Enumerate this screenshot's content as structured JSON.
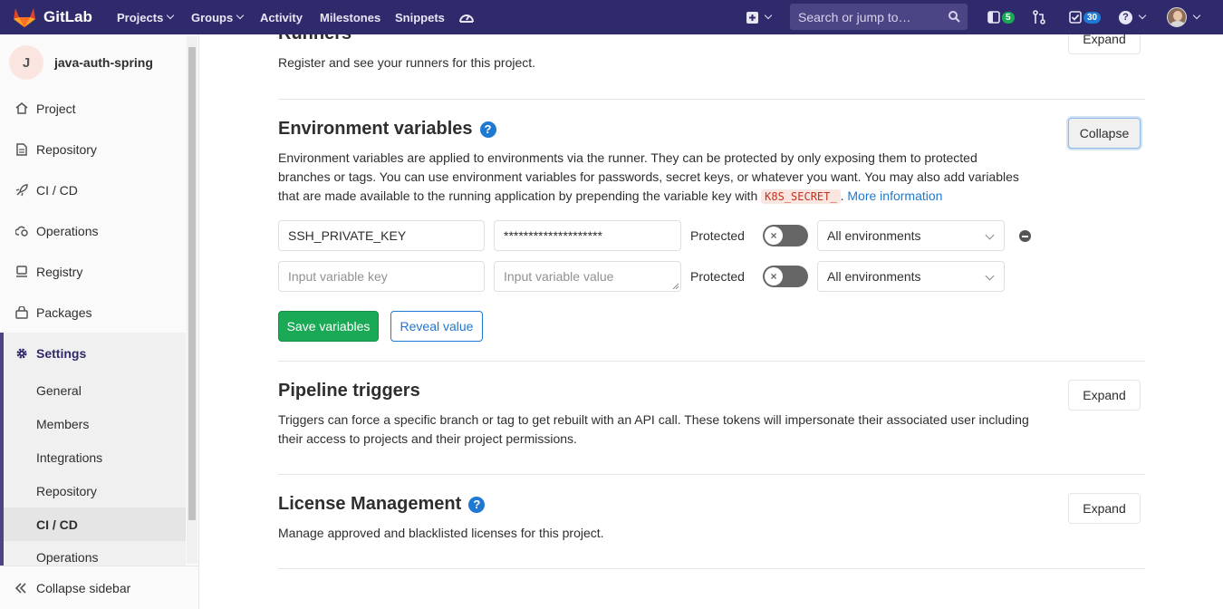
{
  "navbar": {
    "brand": "GitLab",
    "items": [
      {
        "label": "Projects",
        "dropdown": true
      },
      {
        "label": "Groups",
        "dropdown": true
      },
      {
        "label": "Activity"
      },
      {
        "label": "Milestones"
      },
      {
        "label": "Snippets"
      }
    ],
    "search_placeholder": "Search or jump to…",
    "merge_requests_count": "5",
    "todos_count": "30",
    "colors": {
      "bg": "#2f2a6b",
      "mr_badge": "#1aaa55",
      "todo_badge": "#1f78d1"
    }
  },
  "sidebar": {
    "project_initial": "J",
    "project_name": "java-auth-spring",
    "items": [
      {
        "label": "Project",
        "icon": "home-icon"
      },
      {
        "label": "Repository",
        "icon": "doc-icon"
      },
      {
        "label": "CI / CD",
        "icon": "rocket-icon"
      },
      {
        "label": "Operations",
        "icon": "cloud-gear-icon"
      },
      {
        "label": "Registry",
        "icon": "container-icon"
      },
      {
        "label": "Packages",
        "icon": "package-icon"
      },
      {
        "label": "Settings",
        "icon": "gear-icon"
      }
    ],
    "settings_sub": [
      "General",
      "Members",
      "Integrations",
      "Repository",
      "CI / CD",
      "Operations"
    ],
    "active_sub": "CI / CD",
    "collapse_label": "Collapse sidebar"
  },
  "runners": {
    "title": "Runners",
    "desc": "Register and see your runners for this project.",
    "button": "Expand"
  },
  "env_vars": {
    "title": "Environment variables",
    "button": "Collapse",
    "desc_part1": "Environment variables are applied to environments via the runner. They can be protected by only exposing them to protected branches or tags. You can use environment variables for passwords, secret keys, or whatever you want. You may also add variables that are made available to the running application by prepending the variable key with",
    "k8s_code": "K8S_SECRET_",
    "more_info": "More information",
    "rows": [
      {
        "key": "SSH_PRIVATE_KEY",
        "value": "********************",
        "protected_label": "Protected",
        "scope": "All environments"
      },
      {
        "key_placeholder": "Input variable key",
        "value_placeholder": "Input variable value",
        "protected_label": "Protected",
        "scope": "All environments"
      }
    ],
    "save_label": "Save variables",
    "reveal_label": "Reveal value"
  },
  "pipeline_triggers": {
    "title": "Pipeline triggers",
    "desc": "Triggers can force a specific branch or tag to get rebuilt with an API call. These tokens will impersonate their associated user including their access to projects and their project permissions.",
    "button": "Expand"
  },
  "license": {
    "title": "License Management",
    "desc": "Manage approved and blacklisted licenses for this project.",
    "button": "Expand"
  }
}
